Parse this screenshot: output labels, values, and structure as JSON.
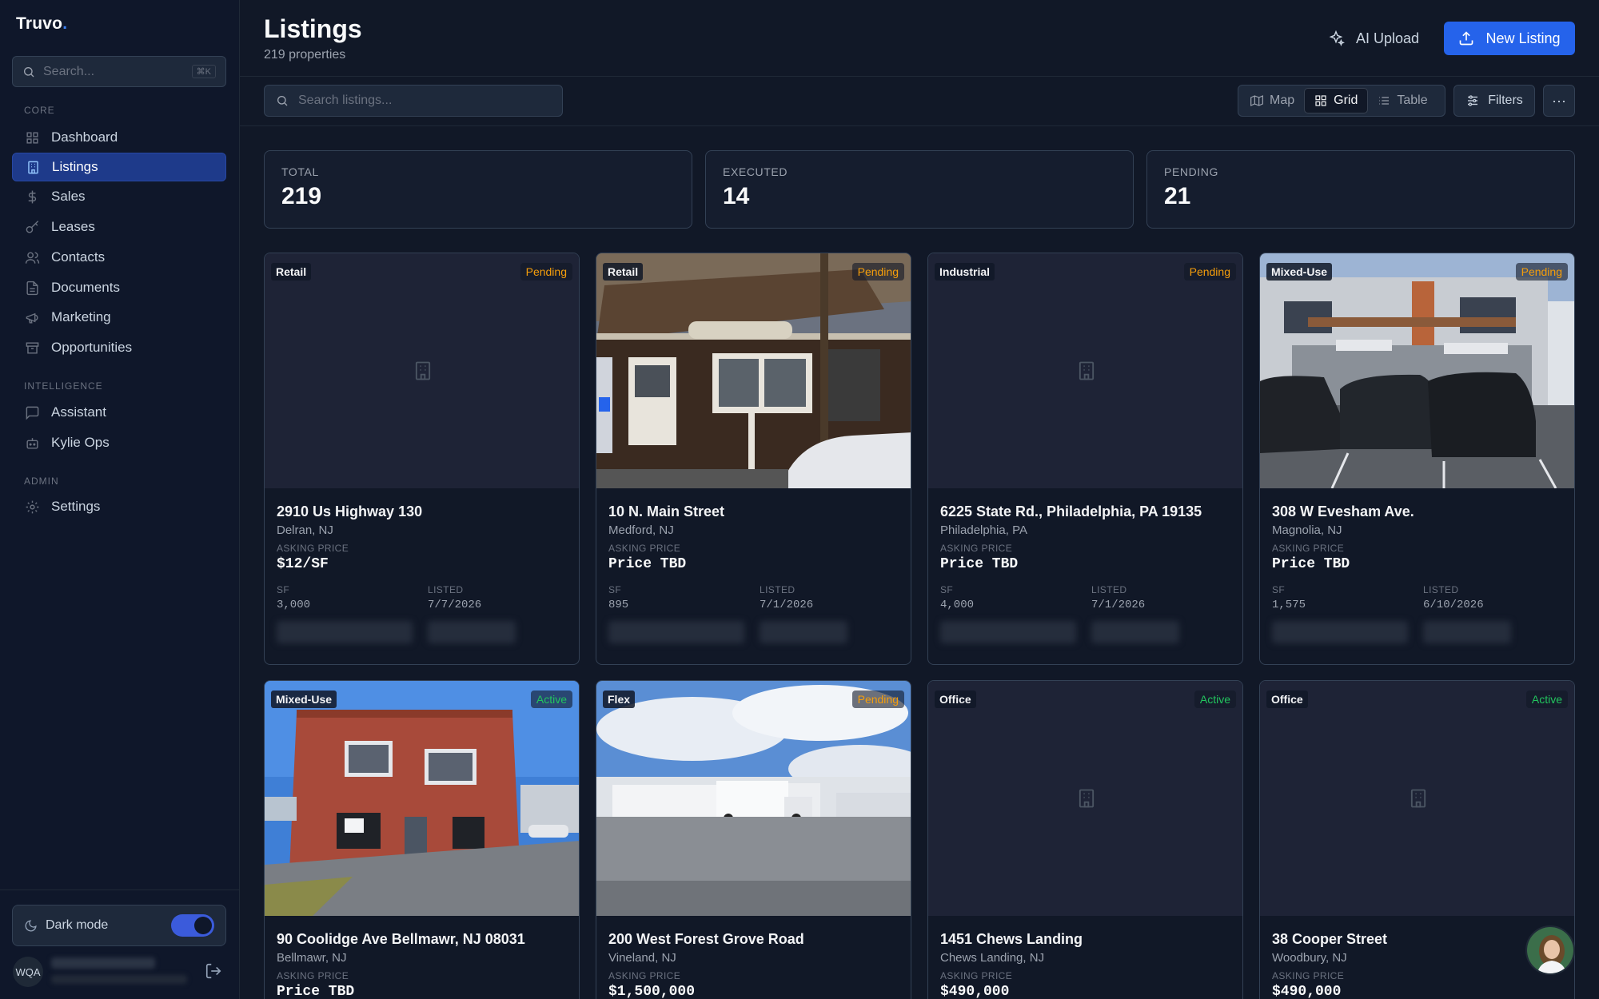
{
  "app": {
    "name": "Truvo",
    "dot": "."
  },
  "sidebar": {
    "search_placeholder": "Search...",
    "search_shortcut": "⌘K",
    "sections": {
      "core": "CORE",
      "intelligence": "INTELLIGENCE",
      "admin": "ADMIN"
    },
    "items": [
      {
        "label": "Dashboard",
        "icon": "grid-icon"
      },
      {
        "label": "Listings",
        "icon": "building-icon",
        "active": true
      },
      {
        "label": "Sales",
        "icon": "dollar-icon"
      },
      {
        "label": "Leases",
        "icon": "key-icon"
      },
      {
        "label": "Contacts",
        "icon": "users-icon"
      },
      {
        "label": "Documents",
        "icon": "document-icon"
      },
      {
        "label": "Marketing",
        "icon": "megaphone-icon"
      },
      {
        "label": "Opportunities",
        "icon": "archive-icon"
      },
      {
        "label": "Assistant",
        "icon": "chat-icon"
      },
      {
        "label": "Kylie Ops",
        "icon": "bot-icon"
      },
      {
        "label": "Settings",
        "icon": "gear-icon"
      }
    ],
    "dark_mode_label": "Dark mode",
    "dark_mode_on": true,
    "user_initials": "WQA"
  },
  "header": {
    "title": "Listings",
    "subtitle": "219 properties",
    "ai_upload_label": "AI Upload",
    "new_listing_label": "New Listing"
  },
  "toolbar": {
    "search_placeholder": "Search listings...",
    "views": [
      {
        "label": "Map",
        "active": false
      },
      {
        "label": "Grid",
        "active": true
      },
      {
        "label": "Table",
        "active": false
      }
    ],
    "filters_label": "Filters",
    "more_label": "···"
  },
  "stats": [
    {
      "label": "TOTAL",
      "value": "219"
    },
    {
      "label": "EXECUTED",
      "value": "14"
    },
    {
      "label": "PENDING",
      "value": "21"
    }
  ],
  "card_labels": {
    "asking_price": "ASKING PRICE",
    "sf": "SF",
    "listed": "LISTED"
  },
  "listings": [
    {
      "type": "Retail",
      "status": "Pending",
      "address": "2910 Us Highway 130",
      "city": "Delran, NJ",
      "price": "$12/SF",
      "sf": "3,000",
      "listed": "7/7/2026"
    },
    {
      "type": "Retail",
      "status": "Pending",
      "address": "10 N. Main Street",
      "city": "Medford, NJ",
      "price": "Price TBD",
      "sf": "895",
      "listed": "7/1/2026"
    },
    {
      "type": "Industrial",
      "status": "Pending",
      "address": "6225 State Rd., Philadelphia, PA 19135",
      "city": "Philadelphia, PA",
      "price": "Price TBD",
      "sf": "4,000",
      "listed": "7/1/2026"
    },
    {
      "type": "Mixed-Use",
      "status": "Pending",
      "address": "308 W Evesham Ave.",
      "city": "Magnolia, NJ",
      "price": "Price TBD",
      "sf": "1,575",
      "listed": "6/10/2026"
    },
    {
      "type": "Mixed-Use",
      "status": "Active",
      "address": "90 Coolidge Ave Bellmawr, NJ 08031",
      "city": "Bellmawr, NJ",
      "price": "Price TBD"
    },
    {
      "type": "Flex",
      "status": "Pending",
      "address": "200 West Forest Grove Road",
      "city": "Vineland, NJ",
      "price": "$1,500,000"
    },
    {
      "type": "Office",
      "status": "Active",
      "address": "1451 Chews Landing",
      "city": "Chews Landing, NJ",
      "price": "$490,000"
    },
    {
      "type": "Office",
      "status": "Active",
      "address": "38 Cooper Street",
      "city": "Woodbury, NJ",
      "price": "$490,000"
    }
  ]
}
